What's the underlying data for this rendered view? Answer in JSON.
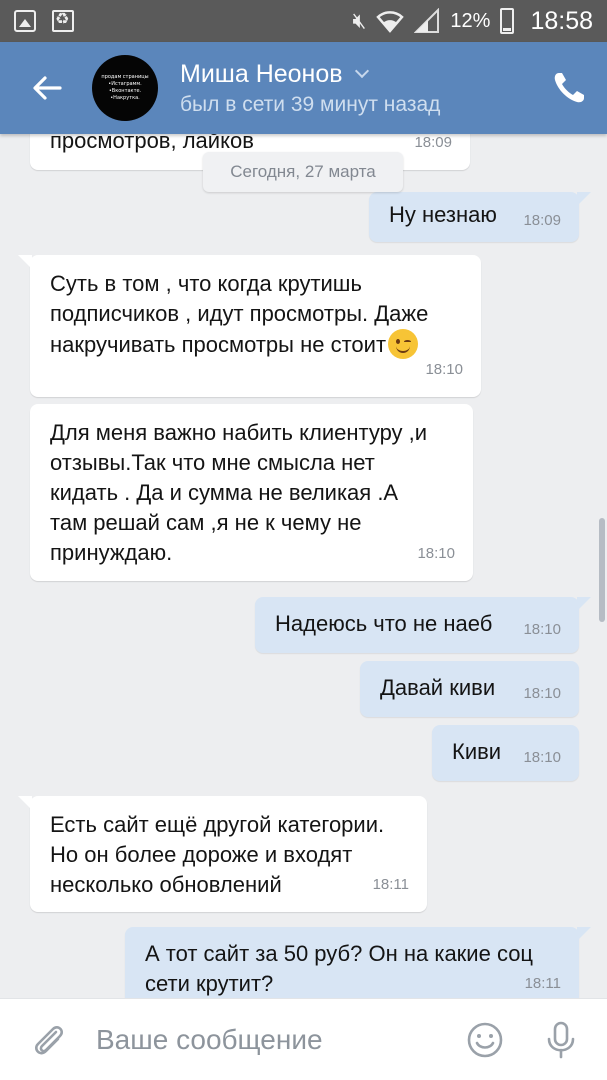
{
  "status_bar": {
    "battery": "12%",
    "time": "18:58"
  },
  "header": {
    "name": "Миша Неонов",
    "status": "был в сети 39 минут назад",
    "avatar_lines": [
      "продам страницы",
      "•Истаграмм.",
      "•Вконтакте.",
      "•Накрутка."
    ]
  },
  "chat": {
    "date_separator": "Сегодня, 27 марта",
    "messages": [
      {
        "side": "in",
        "text": "просмотров, лайков",
        "time": "18:09"
      },
      {
        "side": "out",
        "text": "Ну незнаю",
        "time": "18:09"
      },
      {
        "side": "in",
        "text": "Суть в том , что когда крутишь\nподписчиков , идут просмотры. Даже\nнакручивать просмотры не стоит",
        "emoji": "wink",
        "time": "18:10"
      },
      {
        "side": "in",
        "text": "Для меня важно набить клиентуру ,и\nотзывы.Так что мне смысла нет\nкидать . Да и сумма не великая .А\nтам решай сам ,я не к чему не\nпринуждаю.",
        "time": "18:10"
      },
      {
        "side": "out",
        "text": "Надеюсь что не наеб",
        "time": "18:10"
      },
      {
        "side": "out",
        "text": "Давай киви",
        "time": "18:10"
      },
      {
        "side": "out",
        "text": "Киви",
        "time": "18:10"
      },
      {
        "side": "in",
        "text": "Есть сайт ещё другой категории.\nНо он более дороже и входят\nнесколько обновлений",
        "time": "18:11"
      },
      {
        "side": "out",
        "text": "А тот сайт за 50 руб? Он на какие соц\nсети крутит?",
        "time": "18:11"
      }
    ]
  },
  "input": {
    "placeholder": "Ваше сообщение"
  },
  "colors": {
    "header": "#5b86bb",
    "outgoing_bubble": "#d8e5f4",
    "incoming_bubble": "#ffffff",
    "background": "#edeef0"
  }
}
